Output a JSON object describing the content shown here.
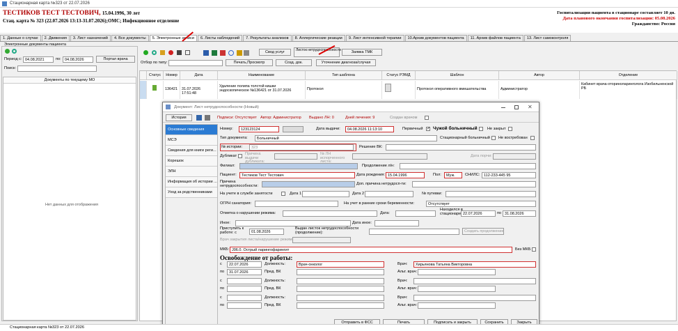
{
  "window": {
    "title": "Стационарная карта №323 от 22.07.2026",
    "taskbar": "Стационарная карта №323 от 22.07.2026"
  },
  "patient": {
    "name": "ТЕСТИКОВ ТЕСТ ТЕСТОВИЧ,",
    "dob_age": "15.04.1996, 30 лет",
    "card": "Стац. карта № 323 (22.07.2026 13:13-31.07.2026);ОМС; Инфекционное отделение",
    "hosp": "Госпитализация пациента в стационаре составляет 10 дн.",
    "planned": "Дата планового окончания госпитализации: 05.08.2026",
    "citizenship": "Гражданство: Россия"
  },
  "tabs": [
    "1. Данные о случае",
    "2. Движения",
    "3. Лист назначений",
    "4. Все документы",
    "5. Электронные записи",
    "6. Листы наблюдений",
    "7. Результаты анализов",
    "8. Аллергические реакции",
    "9. Лист интенсивной терапии",
    "10.Архив документов пациента",
    "11. Архив файлов пациента",
    "13. Лист самоконтроля"
  ],
  "left": {
    "group": "Электронные документы пациента",
    "period_from_label": "Период с:",
    "period_from": "04.08.2021",
    "period_to_label": "по:",
    "period_to": "04.08.2026",
    "portal_btn": "Портал врача",
    "search_label": "Поиск:",
    "list_header": "Документы по текущему МО",
    "no_data": "Нет данных для отображения"
  },
  "toolbar": {
    "filter_label": "Отбор по типу:",
    "print_btn": "Печать,Просмотр",
    "create_btn": "Созд. док.",
    "clarify_btn": "Уточнение диагноза/случая",
    "svod_btn": "Свод услуг",
    "sick_btn": "Листок нетрудоспособности",
    "tmk_btn": "Заявка ТМК"
  },
  "grid": {
    "headers": [
      "Статус",
      "Номер",
      "Дата",
      "Наименование",
      "Тип шаблона",
      "Статус РЭМД",
      "Шаблон",
      "Автор",
      "Отделение"
    ],
    "row": {
      "number": "136421",
      "date": "31.07.2026 17:51:48",
      "name": "Удаление полипа толстой кишки эндоскопическое №136421 от 31.07.2026",
      "type": "Протокол",
      "template": "Протокол оперативного вмешательства",
      "author": "Администратор",
      "dept": "Кабинет врача-оториноларинголога Изобильненской РБ"
    }
  },
  "dialog": {
    "title": "Документ: Лист нетрудоспособности (Новый)",
    "history": "История",
    "signatures": "Подписи: Отсутствует",
    "author": "Автор: Администратор",
    "issued": "Выдано ЛН: 0",
    "days": "Дней лечения:  9",
    "created_by": "Создан врачом",
    "side": [
      "Основные сведения",
      "МСЭ",
      "Сведения для книги реги...",
      "Корешок",
      "ЭЛН",
      "Информация об истории ...",
      "Уход за родственниками"
    ],
    "number_label": "Номер:",
    "number": "123123124",
    "issue_label": "Дата выдачи:",
    "issue_date": "04.08.2026 11:13:10",
    "primary_label": "Первичный",
    "foreign_label": "Чужой больничный",
    "notclosed_label": "Не закрыт",
    "doctype_label": "Тип документа:",
    "doctype": "Больничный",
    "stac_label": "Стационарный больничный",
    "unclaimed_label": "Не востребован",
    "history_label": "№ истории:",
    "history_no": "323",
    "vk_label": "Решение ВК:",
    "duplicate_label": "Дубликат",
    "dup_reason": "Причина выдачи дубликата:",
    "spoiled_label": "№ ЛН испорченного листа:",
    "gap_label": "Дата порчи:",
    "branch_label": "Филиал:",
    "cont_label": "Продолжение л/н:",
    "patient_label": "Пациент:",
    "patient": "Тестиков Тест Тестович",
    "dob_label": "Дата рождения:",
    "dob": "15.04.1996",
    "sex_label": "Пол:",
    "sex": "Муж.",
    "snils_label": "СНИЛС:",
    "snils": "112-233-445 95",
    "cause_label": "Причина нетрудоспособности:",
    "addcause_label": "Доп. причина нетрудосп-ти:",
    "employ_label": "На учете в службе занятости",
    "date1_label": "Дата 1",
    "date2_label": "Дата 2",
    "voucher_label": "№ путевки:",
    "ogrn_label": "ОГРН санатория:",
    "pregn_label": "На учет в ранние сроки беременности:",
    "pregn": "Отсутствует",
    "violation_label": "Отметка о нарушении режима:",
    "date_label": "Дата:",
    "hosp_label": "Находился в стационаре: с",
    "hosp_from": "22.07.2026",
    "hosp_to_label": "по",
    "hosp_to": "31.08.2026",
    "other_label": "Иное:",
    "otherdate_label": "Дата иное:",
    "start_label": "Приступить к работе: с",
    "start": "01.08.2026",
    "issued_cont_label": "Выдан листок нетрудоспособности (продолжение):",
    "cont_btn": "Создать продолжение",
    "closedoc_label": "Врач закрытия листа/нарушение режима:",
    "mkb_label": "МКБ:",
    "mkb": "J06.0. Острый ларингофарингит",
    "nomkb_label": "Без МКБ",
    "release_title": "Освобождение от работы:",
    "from_label": "с",
    "to_label": "по",
    "pos_label": "Должность:",
    "doc_label": "Врач:",
    "prevk_label": "Пред. ВК",
    "altdoc_label": "Альт. врач:",
    "r1_from": "22.07.2026",
    "r1_to": "31.07.2026",
    "r1_pos": "Врач-онколог",
    "r1_doc": "Хирьянова Татьяна Викторовна",
    "send_btn": "Отправить в ФСС",
    "print_btn": "Печать",
    "sign_btn": "Подписать и закрыть",
    "save_btn": "Сохранить",
    "close_btn": "Закрыть"
  }
}
